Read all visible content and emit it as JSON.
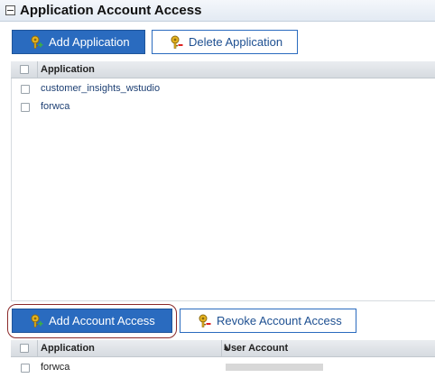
{
  "section": {
    "title": "Application Account Access"
  },
  "toolbar_top": {
    "add_label": "Add Application",
    "delete_label": "Delete Application"
  },
  "applications_table": {
    "column": "Application",
    "rows": [
      "customer_insights_wstudio",
      "forwca"
    ]
  },
  "toolbar_bottom": {
    "add_label": "Add Account Access",
    "revoke_label": "Revoke Account Access"
  },
  "access_table": {
    "columns": [
      "Application",
      "User Account"
    ],
    "rows": [
      {
        "application": "forwca",
        "user_account": ""
      }
    ]
  },
  "colors": {
    "primary_button": "#2a6bbf",
    "link_text": "#1d3f73",
    "highlight_ring": "#8b2a2a"
  },
  "icons": {
    "add": "key-plus-icon",
    "delete": "key-minus-icon"
  }
}
